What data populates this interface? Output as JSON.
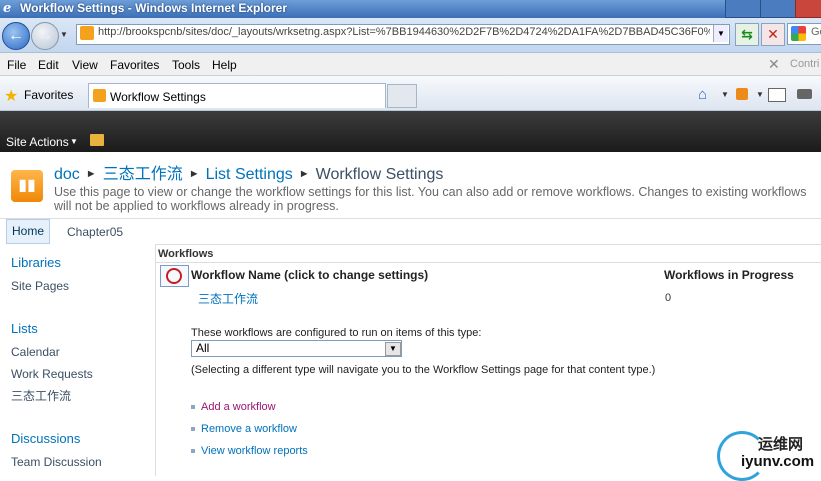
{
  "browser": {
    "window_title": "Workflow Settings - Windows Internet Explorer",
    "address": "http://brookspcnb/sites/doc/_layouts/wrksetng.aspx?List=%7BB1944630%2D2F7B%2D4724%2DA1FA%2D7BBAD45C36F0%7",
    "search_text": "Go",
    "menu": [
      "File",
      "Edit",
      "View",
      "Favorites",
      "Tools",
      "Help"
    ],
    "contribute_label": "Contri",
    "favorites_label": "Favorites",
    "tab_title": "Workflow Settings",
    "icons": [
      "back-arrow",
      "forward-arrow",
      "refresh",
      "stop",
      "home",
      "rss",
      "mail",
      "print"
    ]
  },
  "sharepoint": {
    "site_actions": "Site Actions",
    "breadcrumb": [
      "doc",
      "三态工作流",
      "List Settings",
      "Workflow Settings"
    ],
    "description": "Use this page to view or change the workflow settings for this list. You can also add or remove workflows. Changes to existing workflows will not be applied to workflows already in progress.",
    "top_nav": [
      "Home",
      "Chapter05"
    ],
    "quick_launch": {
      "libraries": {
        "heading": "Libraries",
        "items": [
          "Site Pages"
        ]
      },
      "lists": {
        "heading": "Lists",
        "items": [
          "Calendar",
          "Work Requests",
          "三态工作流"
        ]
      },
      "discussions": {
        "heading": "Discussions",
        "items": [
          "Team Discussion"
        ]
      }
    }
  },
  "main": {
    "section_title": "Workflows",
    "columns": {
      "name": "Workflow Name (click to change settings)",
      "progress": "Workflows in Progress"
    },
    "workflows": [
      {
        "name": "三态工作流",
        "in_progress": "0"
      }
    ],
    "configured_label": "These workflows are configured to run on items of this type:",
    "content_type": "All",
    "content_type_note": "(Selecting a different type will navigate you to the Workflow Settings page for that content type.)",
    "links": [
      "Add a workflow",
      "Remove a workflow",
      "View workflow reports"
    ]
  },
  "watermark": {
    "cn": "运维网",
    "url": "iyunv.com"
  }
}
